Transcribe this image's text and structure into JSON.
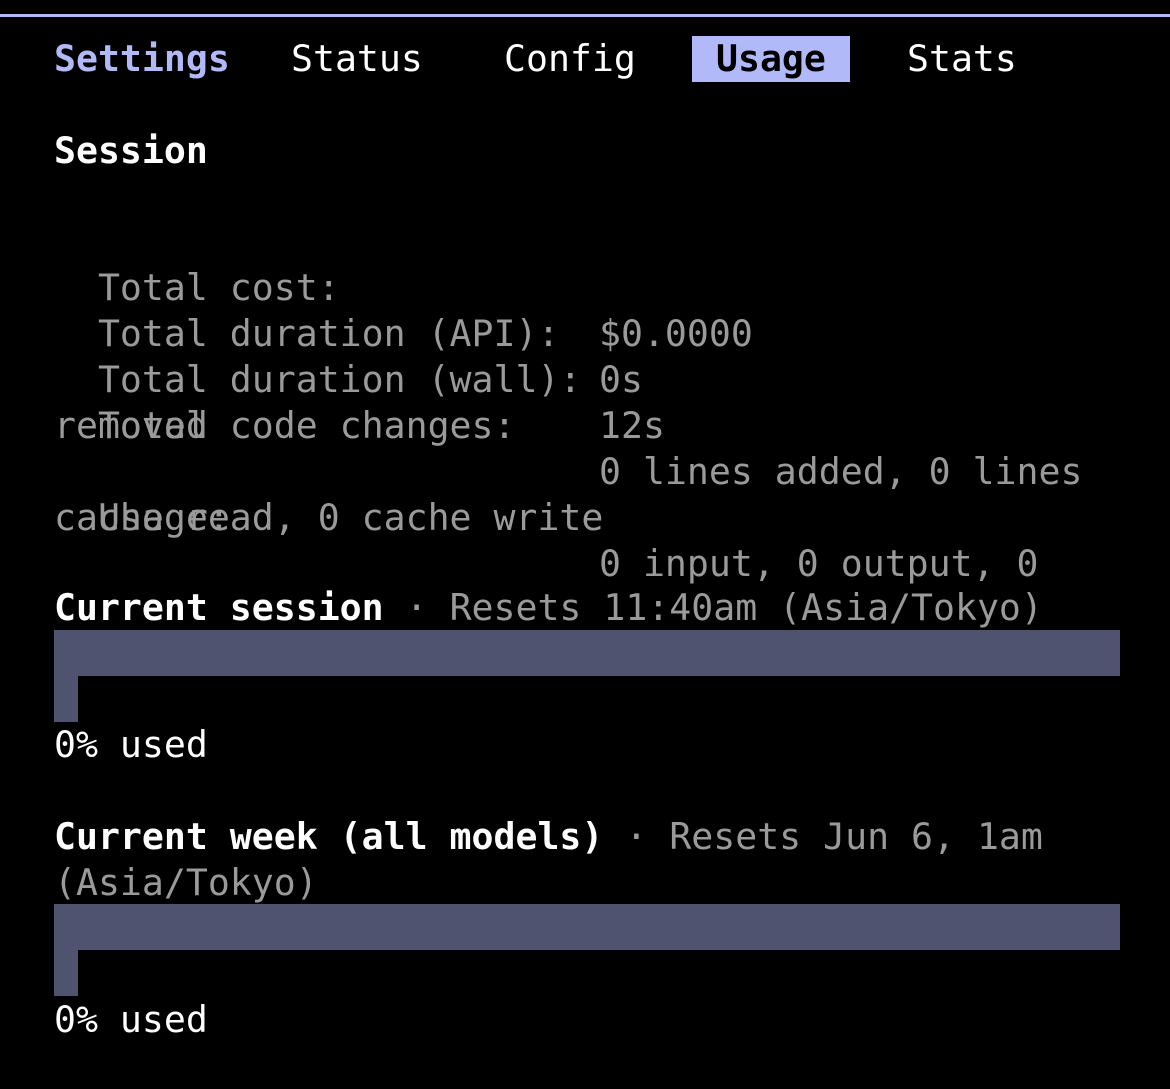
{
  "tabs": {
    "brand": "Settings",
    "items": [
      "Status",
      "Config",
      "Usage",
      "Stats"
    ],
    "active": "Usage"
  },
  "session": {
    "heading": "Session",
    "rows": [
      {
        "label": "Total cost:",
        "value": "$0.0000"
      },
      {
        "label": "Total duration (API):",
        "value": "0s"
      },
      {
        "label": "Total duration (wall):",
        "value": "12s"
      },
      {
        "label": "Total code changes:",
        "value": "0 lines added, 0 lines",
        "value_wrap": "removed"
      },
      {
        "label": "Usage:",
        "value": "0 input, 0 output, 0",
        "value_wrap": "cache read, 0 cache write"
      }
    ]
  },
  "limits": [
    {
      "title": "Current session",
      "separator": " · ",
      "resets": "Resets 11:40am (Asia/Tokyo)",
      "percent_used": 0,
      "used_text": "0% used"
    },
    {
      "title": "Current week (all models)",
      "separator": " · ",
      "resets": "Resets Jun 6, 1am",
      "resets_wrap": "(Asia/Tokyo)",
      "percent_used": 0,
      "used_text": "0% used"
    }
  ],
  "colors": {
    "accent": "#b1b9f9",
    "background": "#000000",
    "bar": "#4f5370",
    "dim_text": "#9a9a9a",
    "text": "#ffffff"
  }
}
